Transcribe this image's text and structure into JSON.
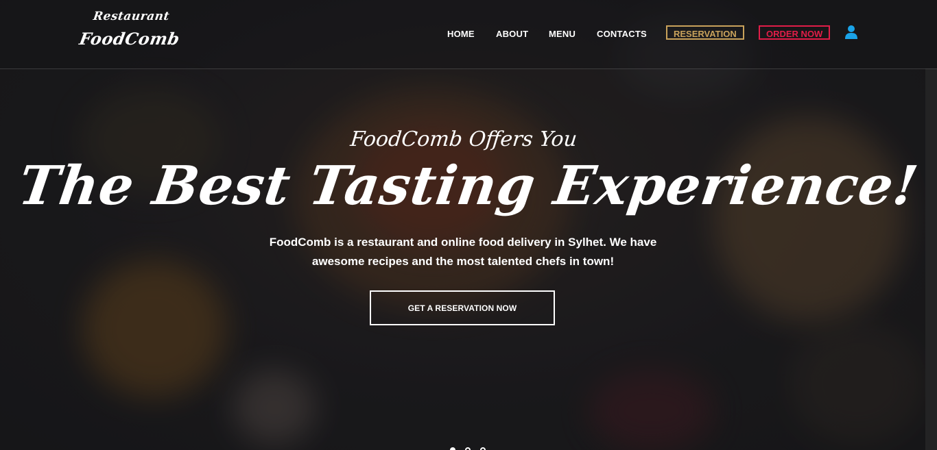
{
  "brand": {
    "top": "Restaurant",
    "main": "FoodComb"
  },
  "nav": {
    "links": [
      "HOME",
      "ABOUT",
      "MENU",
      "CONTACTS"
    ],
    "reservation_label": "RESERVATION",
    "order_label": "ORDER NOW",
    "user_icon": "user-icon"
  },
  "hero": {
    "kicker": "FoodComb Offers You",
    "title": "The Best Tasting Experience!",
    "description": "FoodComb is a restaurant and online food delivery in Sylhet. We have awesome recipes and the most talented chefs in town!",
    "cta_label": "GET A RESERVATION NOW"
  },
  "carousel": {
    "slides": 3,
    "active_index": 0
  },
  "colors": {
    "reservation": "#c9a25b",
    "order": "#e11d48",
    "user_icon": "#1aa3e8"
  }
}
